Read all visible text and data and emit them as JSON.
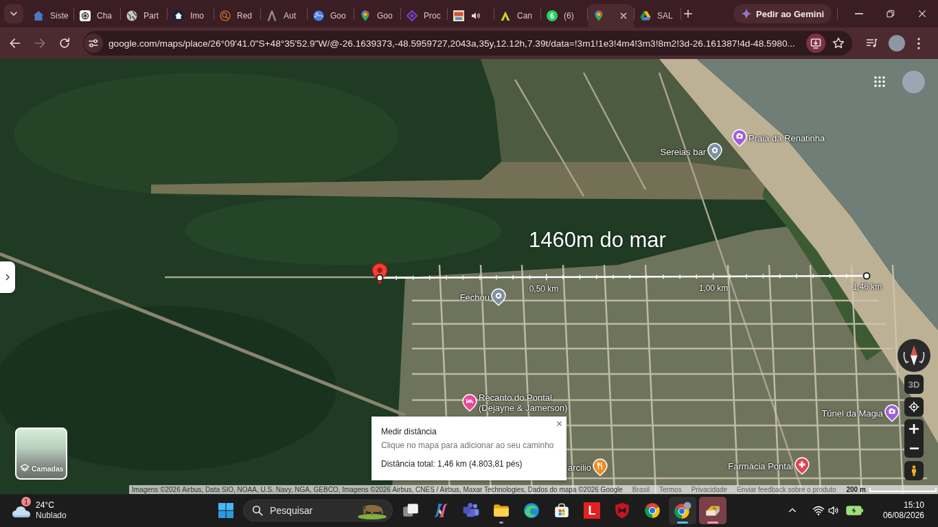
{
  "browser": {
    "tabs": [
      {
        "kind": "house",
        "title": "Siste",
        "selected": false,
        "audio": false
      },
      {
        "kind": "knot",
        "title": "Cha",
        "selected": false,
        "audio": false
      },
      {
        "kind": "globe",
        "title": "Part",
        "selected": false,
        "audio": false
      },
      {
        "kind": "home",
        "title": "Imo",
        "selected": false,
        "audio": false
      },
      {
        "kind": "magnifier",
        "title": "Red",
        "selected": false,
        "audio": false
      },
      {
        "kind": "peak",
        "title": "Aut",
        "selected": false,
        "audio": false
      },
      {
        "kind": "sphere",
        "title": "Goo",
        "selected": false,
        "audio": false
      },
      {
        "kind": "pin",
        "title": "Goo",
        "selected": false,
        "audio": false
      },
      {
        "kind": "diamond",
        "title": "Proc",
        "selected": false,
        "audio": false
      },
      {
        "kind": "picture",
        "selected": false,
        "audio": true
      },
      {
        "kind": "arrowhead",
        "title": "Can",
        "selected": false,
        "audio": false
      },
      {
        "kind": "counter",
        "badge": "6",
        "title": "(6)",
        "selected": false,
        "audio": false
      },
      {
        "kind": "pin",
        "selected": true,
        "audio": false
      },
      {
        "kind": "drive",
        "title": "SAL",
        "selected": false,
        "audio": false
      }
    ],
    "gemini_button": "Pedir ao Gemini",
    "forward_disabled": true,
    "url": "google.com/maps/place/26°09'41.0\"S+48°35'52.9\"W/@-26.1639373,-48.5959727,2043a,35y,12.12h,7.39t/data=!3m1!1e3!4m4!3m3!8m2!3d-26.161387!4d-48.5980..."
  },
  "map": {
    "annotation": "1460m do mar",
    "distance_marks": [
      "0,50 km",
      "1,00 km",
      "1,46 km"
    ],
    "places": [
      {
        "name": "Praia da Renatinha",
        "kind": "attraction"
      },
      {
        "name": "Sereias bar",
        "kind": "place"
      },
      {
        "name": "Fechou",
        "kind": "place"
      },
      {
        "name": "Recanto do Pontal (Dejayne & Jamerson)",
        "kind": "hotel"
      },
      {
        "name": "Túnel da Magia",
        "kind": "attraction"
      },
      {
        "name": "arcilio",
        "kind": "restaurant"
      },
      {
        "name": "Farmácia Pontal",
        "kind": "pharmacy"
      }
    ],
    "tilt_button": "3D",
    "layers_label": "Camadas",
    "measure_panel": {
      "title": "Medir distância",
      "hint": "Clique no mapa para adicionar ao seu caminho",
      "total": "Distância total: 1,46 km (4.803,81 pés)"
    },
    "attribution": "Imagens ©2026 Airbus, Data SIO, NOAA, U.S. Navy, NGA, GEBCO, Imagens ©2026 Airbus, CNES / Airbus, Maxar Technologies, Dados do mapa ©2026 Google",
    "footer_links": [
      "Brasil",
      "Termos",
      "Privacidade",
      "Enviar feedback sobre o produto"
    ],
    "scale": "200 m"
  },
  "taskbar": {
    "weather": {
      "badge": "1",
      "temperature": "24°C",
      "condition": "Nublado"
    },
    "search": {
      "placeholder": "Pesquisar"
    },
    "apps": [
      {
        "kind": "tasks",
        "running": false,
        "selected": false,
        "attention": false
      },
      {
        "kind": "copilot",
        "running": false,
        "selected": false,
        "attention": false
      },
      {
        "kind": "teams",
        "running": false,
        "selected": false,
        "attention": false
      },
      {
        "kind": "folder",
        "running": true,
        "selected": false,
        "attention": false
      },
      {
        "kind": "edge",
        "running": false,
        "selected": false,
        "attention": false
      },
      {
        "kind": "store",
        "running": false,
        "selected": false,
        "attention": false
      },
      {
        "kind": "letter",
        "label": "L",
        "running": false,
        "selected": false,
        "attention": false
      },
      {
        "kind": "shield",
        "running": false,
        "selected": false,
        "attention": false
      },
      {
        "kind": "chrome",
        "running": false,
        "selected": false,
        "attention": false
      },
      {
        "kind": "profile",
        "running": true,
        "selected": true,
        "attention": false
      },
      {
        "kind": "usb",
        "running": true,
        "selected": false,
        "attention": true
      }
    ],
    "time": "15:10",
    "date": "06/08/2026"
  }
}
